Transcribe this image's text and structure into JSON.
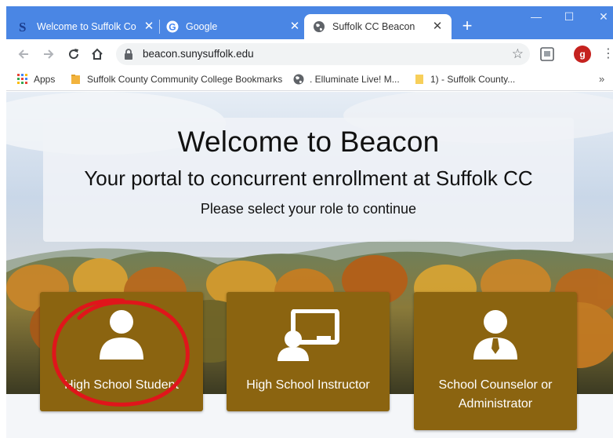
{
  "browser": {
    "tabs": [
      {
        "title": "Welcome to Suffolk Co",
        "icon": "suffolk-s-icon",
        "active": false
      },
      {
        "title": "Google",
        "icon": "google-g-icon",
        "active": false
      },
      {
        "title": "Suffolk CC Beacon",
        "icon": "globe-icon",
        "active": true
      }
    ],
    "address": "beacon.sunysuffolk.edu",
    "profile_initial": "g",
    "bookmarks": [
      {
        "label": "Apps",
        "icon": "apps-grid-icon"
      },
      {
        "label": "Suffolk County Community College Bookmarks",
        "icon": "folder-icon"
      },
      {
        "label": ". Elluminate Live! M...",
        "icon": "globe-icon"
      },
      {
        "label": "1) - Suffolk County...",
        "icon": "page-icon"
      }
    ],
    "bookmarks_more": "»",
    "colors": {
      "tabstrip": "#4a86e4",
      "profile": "#c5221f"
    }
  },
  "page": {
    "title": "Welcome to Beacon",
    "subtitle": "Your portal to concurrent enrollment at Suffolk CC",
    "prompt": "Please select your role to continue",
    "roles": [
      {
        "label": "High School Student",
        "icon": "student-person-icon"
      },
      {
        "label": "High School Instructor",
        "icon": "instructor-whiteboard-icon"
      },
      {
        "label": "School Counselor or Administrator",
        "icon": "counselor-tie-icon"
      }
    ],
    "colors": {
      "card": "#8b6410",
      "annotation": "#e0151b"
    }
  }
}
